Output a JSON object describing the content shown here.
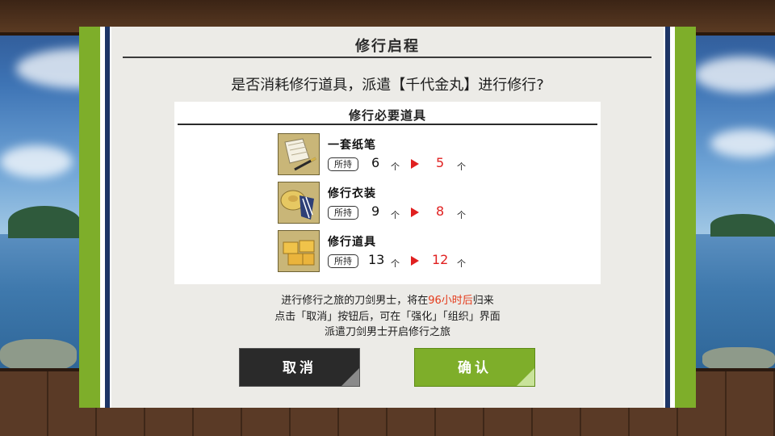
{
  "dialog": {
    "title": "修行启程",
    "question": "是否消耗修行道具，派遣【千代金丸】进行修行?",
    "items_panel_title": "修行必要道具",
    "own_label": "所持",
    "unit": "个",
    "items": [
      {
        "name": "一套纸笔",
        "icon": "paper-brush-icon",
        "have": "6",
        "after": "5"
      },
      {
        "name": "修行衣装",
        "icon": "travel-outfit-icon",
        "have": "9",
        "after": "8"
      },
      {
        "name": "修行道具",
        "icon": "training-tools-icon",
        "have": "13",
        "after": "12"
      }
    ],
    "notice": {
      "line1_pre": "进行修行之旅的刀剑男士，将在",
      "line1_highlight": "96小时后",
      "line1_post": "归来",
      "line2": "点击「取消」按钮后，可在「强化」「组织」界面",
      "line3": "派遣刀剑男士开启修行之旅"
    },
    "cancel_label": "取消",
    "confirm_label": "确认"
  },
  "colors": {
    "accent_green": "#7eae2a",
    "stripe_navy": "#1d3566",
    "highlight_red": "#e43a1a",
    "arrow_red": "#e02020"
  }
}
